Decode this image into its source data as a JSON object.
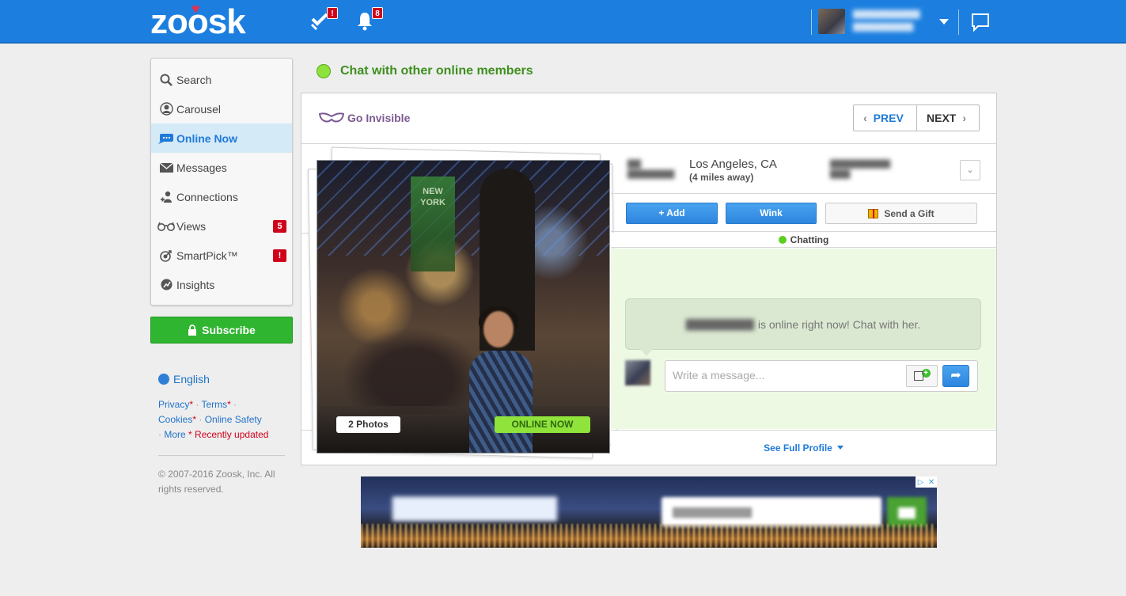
{
  "header": {
    "logo_text": "zoosk",
    "notifications_badge": "!",
    "alerts_badge": "8"
  },
  "sidebar": {
    "items": [
      {
        "label": "Search",
        "icon": "search-icon"
      },
      {
        "label": "Carousel",
        "icon": "carousel-icon"
      },
      {
        "label": "Online Now",
        "icon": "chat-bubble-icon",
        "active": true
      },
      {
        "label": "Messages",
        "icon": "envelope-icon"
      },
      {
        "label": "Connections",
        "icon": "connections-icon"
      },
      {
        "label": "Views",
        "icon": "glasses-icon",
        "badge": "5"
      },
      {
        "label": "SmartPick™",
        "icon": "target-icon",
        "badge": "!"
      },
      {
        "label": "Insights",
        "icon": "insights-icon"
      }
    ],
    "subscribe_label": "Subscribe",
    "language": "English",
    "footer": {
      "privacy": "Privacy",
      "terms": "Terms",
      "cookies": "Cookies",
      "online_safety": "Online Safety",
      "more": "More",
      "asterisk": "*",
      "recently_updated": "* Recently updated",
      "sep": "·",
      "copyright": "© 2007-2016 Zoosk, Inc. All rights reserved."
    }
  },
  "main": {
    "title": "Chat with other online members",
    "go_invisible": "Go Invisible",
    "prev_label": "PREV",
    "next_label": "NEXT",
    "photo_count": "2 Photos",
    "online_now_label": "ONLINE NOW",
    "photo_sign_text": "NEW YORK",
    "location": "Los Angeles, CA",
    "distance": "(4 miles away)",
    "add_label": "+ Add",
    "wink_label": "Wink",
    "gift_label": "Send a Gift",
    "chatting_label": "Chatting",
    "online_message": "is online right now! Chat with her.",
    "message_placeholder": "Write a message...",
    "see_full_profile": "See Full Profile"
  },
  "colors": {
    "header_blue": "#1c7fe0",
    "accent_blue": "#1f7ad9",
    "online_green": "#8ee23d",
    "subscribe_green": "#2fb52f",
    "badge_red": "#d0021b",
    "invisible_purple": "#7c5a92"
  }
}
